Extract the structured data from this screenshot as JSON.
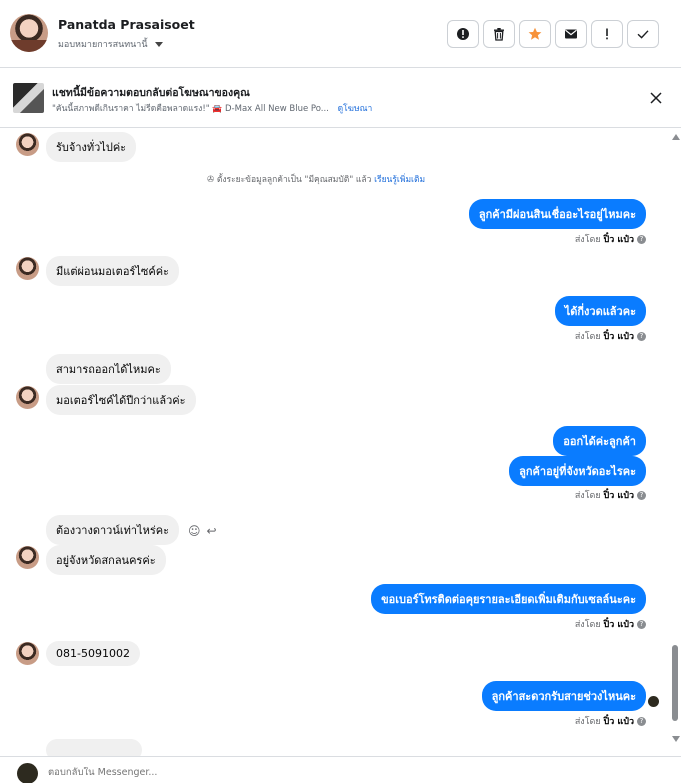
{
  "header": {
    "name": "Panatda Prasaisoet",
    "assign_label": "มอบหมายการสนทนานี้",
    "actions": [
      "spam-icon",
      "trash-icon",
      "star-icon",
      "mail-icon",
      "alert-icon",
      "check-icon"
    ],
    "star_color": "#f7923a"
  },
  "ad": {
    "title": "แชทนี้มีข้อความตอบกลับต่อโฆษณาของคุณ",
    "quote": "\"คันนี้สภาพดีเกินราคา ไม่รีดคือพลาดแรง!\"",
    "car_icon": "car-icon",
    "product": "D-Max All New Blue Po...",
    "link": "ดูโฆษณา"
  },
  "chat": {
    "accent": "#0a7cff",
    "sent_by_prefix": "ส่งโดย",
    "sent_by_name": "ปิ๋ว แป๋ว",
    "system_note": {
      "text": "ตั้งระยะข้อมูลลูกค้าเป็น \"มีคุณสมบัติ\" แล้ว",
      "link": "เรียนรู้เพิ่มเติม"
    },
    "messages": {
      "m1": "รับจ้างทั่วไปค่ะ",
      "m2": "ลูกค้ามีผ่อนสินเชื่ออะไรอยู่ไหมคะ",
      "m3": "มีแต่ผ่อนมอเตอร์ไซค์ค่ะ",
      "m4": "ได้กี่งวดแล้วคะ",
      "m5": "สามารถออกได้ไหมคะ",
      "m6": "มอเตอร์ไซค์ได้ปีกว่าแล้วค่ะ",
      "m7": "ออกได้ค่ะลูกค้า",
      "m8": "ลูกค้าอยู่ที่จังหวัดอะไรคะ",
      "m9": "ต้องวางดาวน์เท่าไหร่คะ",
      "m10": "อยู่จังหวัดสกลนครค่ะ",
      "m11": "ขอเบอร์โทรติดต่อคุยรายละเอียดเพิ่มเติมกับเซลล์นะคะ",
      "m12": "081-5091002",
      "m13": "ลูกค้าสะดวกรับสายช่วงไหนคะ"
    }
  },
  "composer": {
    "placeholder": "ตอบกลับใน Messenger..."
  }
}
